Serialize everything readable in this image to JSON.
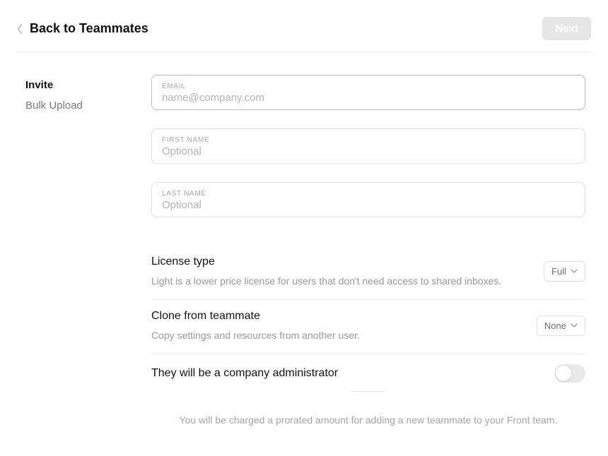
{
  "header": {
    "back_label": "Back to Teammates",
    "next_label": "Next"
  },
  "sidebar": {
    "items": [
      {
        "label": "Invite",
        "active": true
      },
      {
        "label": "Bulk Upload",
        "active": false
      }
    ]
  },
  "form": {
    "email": {
      "label": "EMAIL",
      "placeholder": "name@company.com",
      "value": ""
    },
    "first_name": {
      "label": "FIRST NAME",
      "placeholder": "Optional",
      "value": ""
    },
    "last_name": {
      "label": "LAST NAME",
      "placeholder": "Optional",
      "value": ""
    }
  },
  "license": {
    "title": "License type",
    "desc": "Light is a lower price license for users that don't need access to shared inboxes.",
    "value": "Full"
  },
  "clone": {
    "title": "Clone from teammate",
    "desc": "Copy settings and resources from another user.",
    "value": "None"
  },
  "admin": {
    "title": "They will be a company administrator",
    "value": false
  },
  "footer": {
    "note": "You will be charged a prorated amount for adding a new teammate to your Front team."
  }
}
